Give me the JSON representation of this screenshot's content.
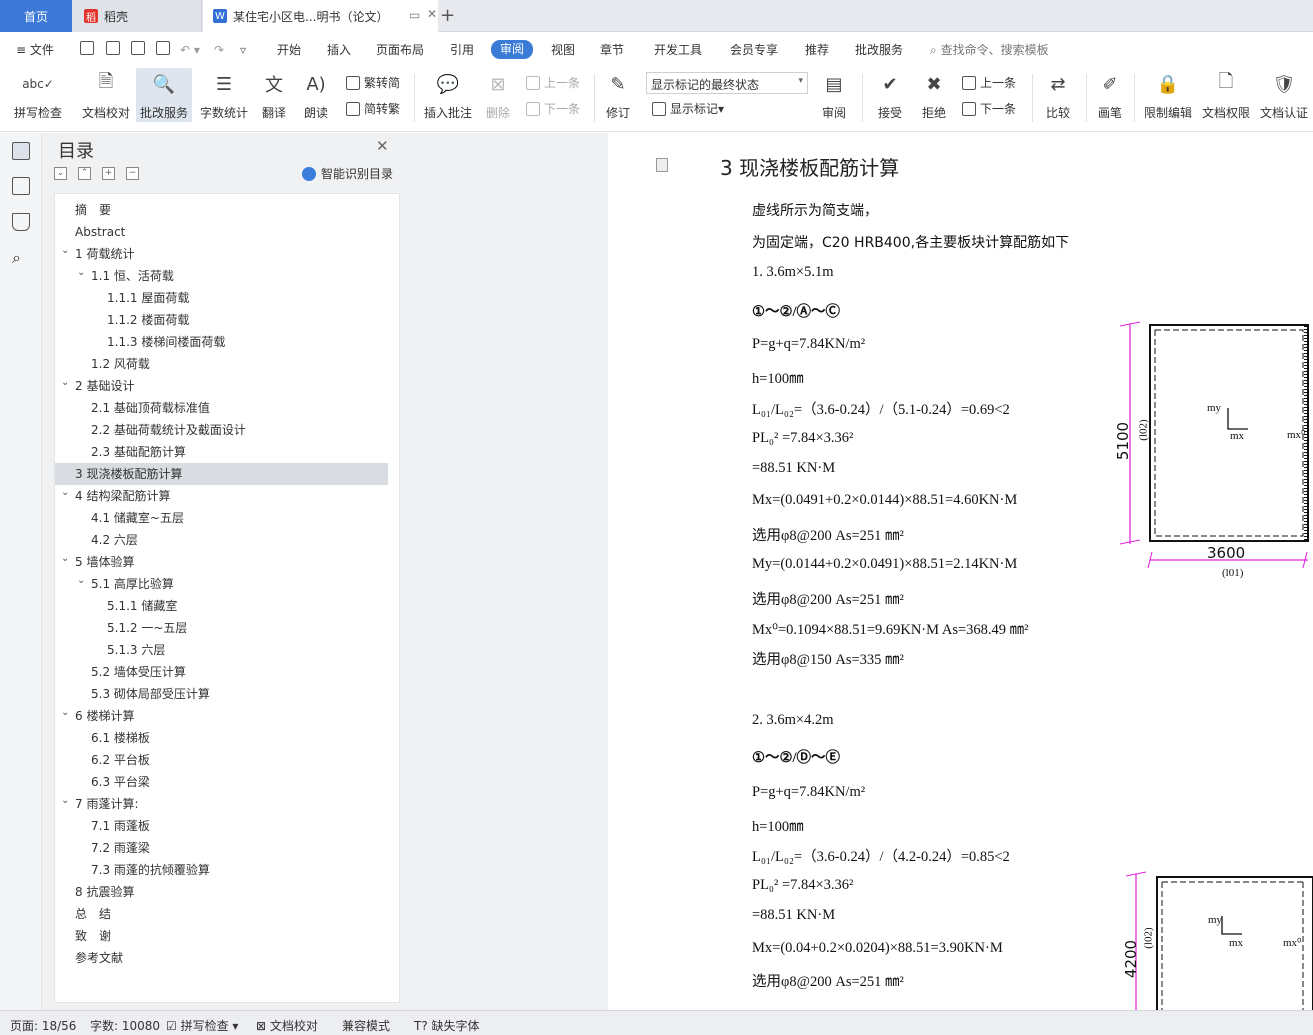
{
  "tabs": {
    "home": "首页",
    "t1": "稻壳",
    "t2": "某住宅小区电...明书（论文）"
  },
  "menu": {
    "file": "文件",
    "items": [
      "开始",
      "插入",
      "页面布局",
      "引用",
      "审阅",
      "视图",
      "章节",
      "开发工具",
      "会员专享",
      "推荐",
      "批改服务"
    ],
    "search": "查找命令、搜索模板"
  },
  "ribbon": {
    "spell": "拼写检查",
    "proof": "文档校对",
    "grade": "批改服务",
    "count": "字数统计",
    "translate": "翻译",
    "read": "朗读",
    "t2s": "繁转简",
    "s2t": "简转繁",
    "insert_comment": "插入批注",
    "delete": "删除",
    "prev1": "上一条",
    "next1": "下一条",
    "revise": "修订",
    "mark_state": "显示标记的最终状态",
    "show_marks": "显示标记",
    "review": "审阅",
    "accept": "接受",
    "reject": "拒绝",
    "prev2": "上一条",
    "next2": "下一条",
    "compare": "比较",
    "pen": "画笔",
    "restrict": "限制编辑",
    "perm": "文档权限",
    "cert": "文档认证"
  },
  "toc": {
    "title": "目录",
    "smart": "智能识别目录",
    "items": [
      {
        "label": "摘　要",
        "level": 0,
        "arrow": ""
      },
      {
        "label": "Abstract",
        "level": 0,
        "arrow": ""
      },
      {
        "label": "1  荷载统计",
        "level": 0,
        "arrow": "v"
      },
      {
        "label": "1.1 恒、活荷载",
        "level": 1,
        "arrow": "v"
      },
      {
        "label": "1.1.1 屋面荷载",
        "level": 2,
        "arrow": ""
      },
      {
        "label": "1.1.2  楼面荷载",
        "level": 2,
        "arrow": ""
      },
      {
        "label": "1.1.3  楼梯间楼面荷载",
        "level": 2,
        "arrow": ""
      },
      {
        "label": "1.2  风荷载",
        "level": 1,
        "arrow": ""
      },
      {
        "label": "2  基础设计",
        "level": 0,
        "arrow": "v"
      },
      {
        "label": "2.1  基础顶荷载标准值",
        "level": 1,
        "arrow": ""
      },
      {
        "label": "2.2  基础荷载统计及截面设计",
        "level": 1,
        "arrow": ""
      },
      {
        "label": "2.3  基础配筋计算",
        "level": 1,
        "arrow": ""
      },
      {
        "label": "3  现浇楼板配筋计算",
        "level": 0,
        "arrow": "",
        "selected": true
      },
      {
        "label": "4  结构梁配筋计算",
        "level": 0,
        "arrow": "v"
      },
      {
        "label": "4.1  储藏室~五层",
        "level": 1,
        "arrow": ""
      },
      {
        "label": "4.2  六层",
        "level": 1,
        "arrow": ""
      },
      {
        "label": "5  墙体验算",
        "level": 0,
        "arrow": "v"
      },
      {
        "label": "5.1  高厚比验算",
        "level": 1,
        "arrow": "v"
      },
      {
        "label": "5.1.1 储藏室",
        "level": 2,
        "arrow": ""
      },
      {
        "label": "5.1.2  一~五层",
        "level": 2,
        "arrow": ""
      },
      {
        "label": "5.1.3  六层",
        "level": 2,
        "arrow": ""
      },
      {
        "label": "5.2  墙体受压计算",
        "level": 1,
        "arrow": ""
      },
      {
        "label": "5.3  砌体局部受压计算",
        "level": 1,
        "arrow": ""
      },
      {
        "label": "6  楼梯计算",
        "level": 0,
        "arrow": "v"
      },
      {
        "label": "6.1  楼梯板",
        "level": 1,
        "arrow": ""
      },
      {
        "label": "6.2  平台板",
        "level": 1,
        "arrow": ""
      },
      {
        "label": "6.3  平台梁",
        "level": 1,
        "arrow": ""
      },
      {
        "label": "7  雨蓬计算:",
        "level": 0,
        "arrow": "v"
      },
      {
        "label": "7.1  雨蓬板",
        "level": 1,
        "arrow": ""
      },
      {
        "label": "7.2  雨蓬梁",
        "level": 1,
        "arrow": ""
      },
      {
        "label": "7.3  雨蓬的抗倾覆验算",
        "level": 1,
        "arrow": ""
      },
      {
        "label": "8  抗震验算",
        "level": 0,
        "arrow": ""
      },
      {
        "label": "总　结",
        "level": 0,
        "arrow": ""
      },
      {
        "label": "致　谢",
        "level": 0,
        "arrow": ""
      },
      {
        "label": "参考文献",
        "level": 0,
        "arrow": ""
      }
    ]
  },
  "doc": {
    "heading": "3  现浇楼板配筋计算",
    "lines": [
      "虚线所示为简支端，",
      "为固定端，C20    HRB400,各主要板块计算配筋如下",
      "1.      3.6m×5.1m",
      "①～②/Ⓐ～Ⓒ",
      "P=g+q=7.84KN/m²",
      "  h=100㎜",
      "L₀₁/L₀₂=（3.6-0.24）/（5.1-0.24）=0.69<2",
      "PL₀² =7.84×3.36²",
      "       =88.51 KN·M",
      "Mx=(0.0491+0.2×0.0144)×88.51=4.60KN·M",
      "  选用φ8@200        As=251 ㎜²",
      "My=(0.0144+0.2×0.0491)×88.51=2.14KN·M",
      "选用φ8@200        As=251 ㎜²",
      "Mx⁰=0.1094×88.51=9.69KN·M        As=368.49 ㎜²",
      "选用φ8@150        As=335 ㎜²",
      "2.      3.6m×4.2m",
      "①～②/Ⓓ～Ⓔ",
      "P=g+q=7.84KN/m²",
      "  h=100㎜",
      "L₀₁/L₀₂=（3.6-0.24）/（4.2-0.24）=0.85<2",
      "PL₀² =7.84×3.36²",
      "       =88.51 KN·M",
      "Mx=(0.04+0.2×0.0204)×88.51=3.90KN·M",
      "  选用φ8@200        As=251 ㎜²"
    ],
    "fig1": {
      "dim_v": "5100",
      "dim_h": "3600",
      "l02": "(l02)",
      "l01": "(l01)",
      "my": "my",
      "mx": "mx",
      "mx0": "mx⁰"
    },
    "fig2": {
      "dim_v": "4200",
      "l02": "(l02)",
      "my": "my",
      "mx": "mx",
      "mx0": "mx⁰"
    }
  },
  "status": {
    "page": "页面: 18/56",
    "words": "字数: 10080",
    "spell": "拼写检查",
    "proof": "文档校对",
    "compat": "兼容模式",
    "font": "缺失字体"
  }
}
